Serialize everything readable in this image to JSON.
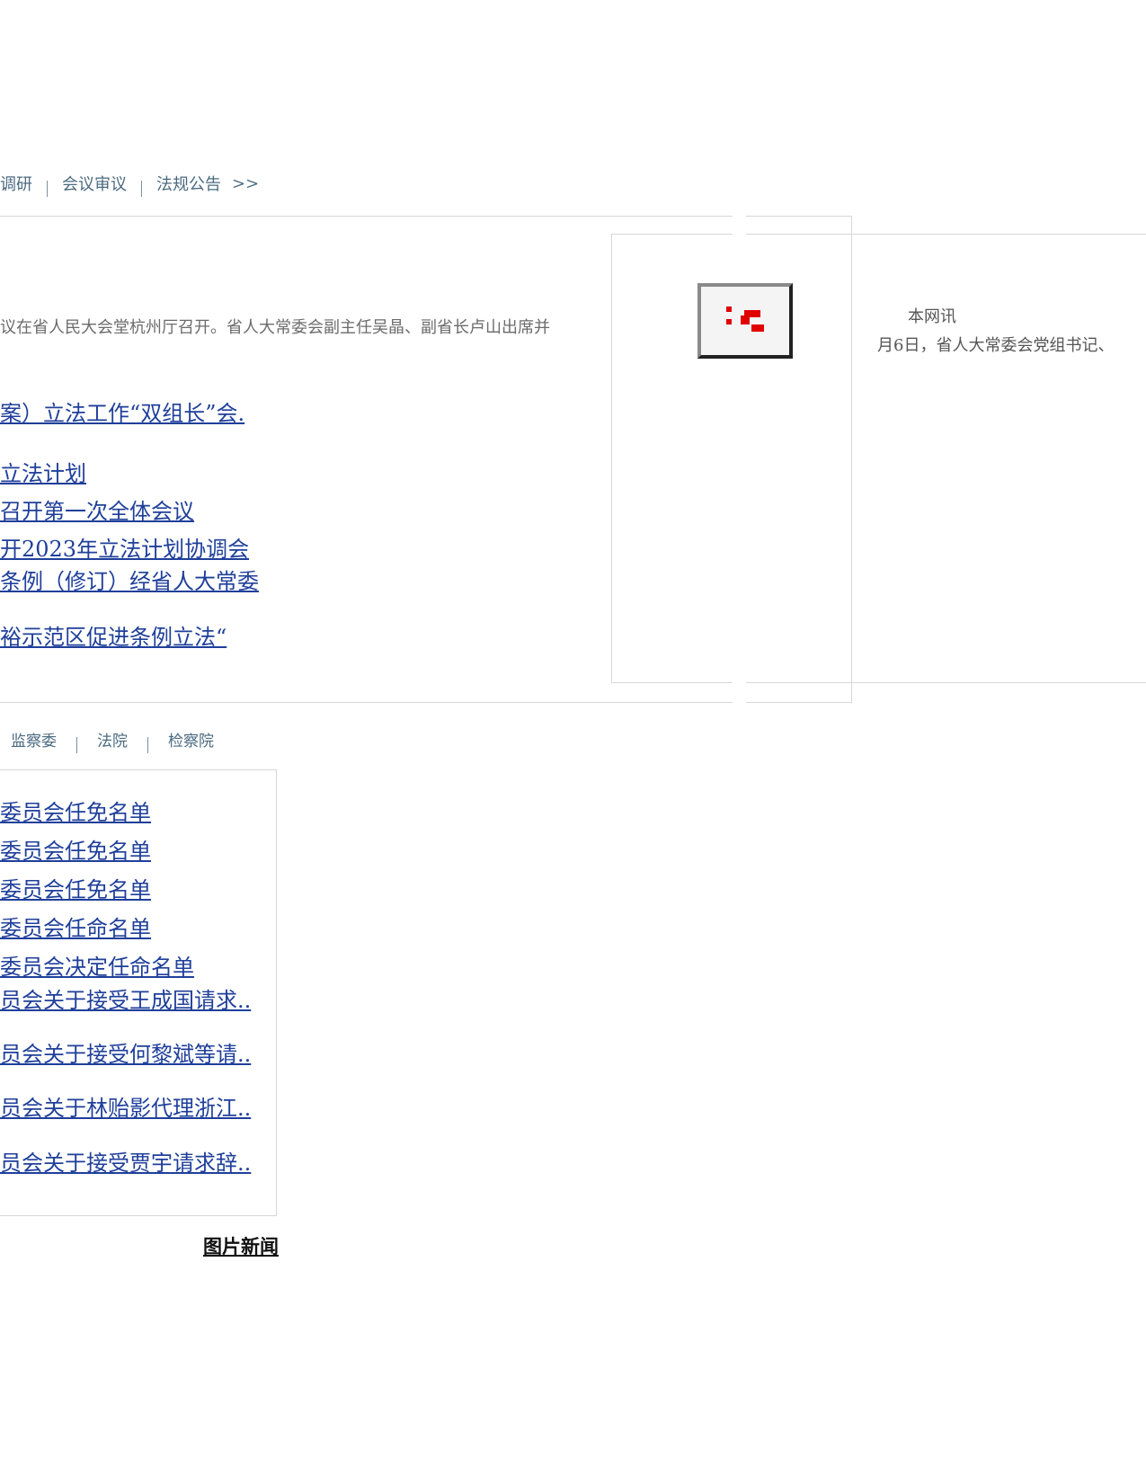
{
  "top_tabs": {
    "items": [
      {
        "label": "调研"
      },
      {
        "label": "会议审议"
      },
      {
        "label": "法规公告"
      }
    ],
    "more": ">>"
  },
  "headline_summary": "议在省人民大会堂杭州厅召开。省人大常委会副主任吴晶、副省长卢山出席并",
  "news_links": [
    "案）立法工作“双组长”会.",
    "立法计划",
    "召开第一次全体会议",
    "开2023年立法计划协调会",
    "条例（修订）经省人大常委",
    "裕示范区促进条例立法“"
  ],
  "right_panel": {
    "title": "本网讯",
    "desc": "月6日，省人大常委会党组书记、"
  },
  "bottom_tabs": {
    "items": [
      {
        "label": "监察委"
      },
      {
        "label": "法院"
      },
      {
        "label": "检察院"
      }
    ]
  },
  "list_links": [
    "委员会任免名单",
    "委员会任免名单",
    "委员会任免名单",
    "委员会任命名单",
    "委员会决定任命名单",
    "员会关于接受王成国请求..",
    "员会关于接受何黎斌等请..",
    "员会关于林贻影代理浙江..",
    "员会关于接受贾宇请求辞.."
  ],
  "photo_news": "图片新闻"
}
